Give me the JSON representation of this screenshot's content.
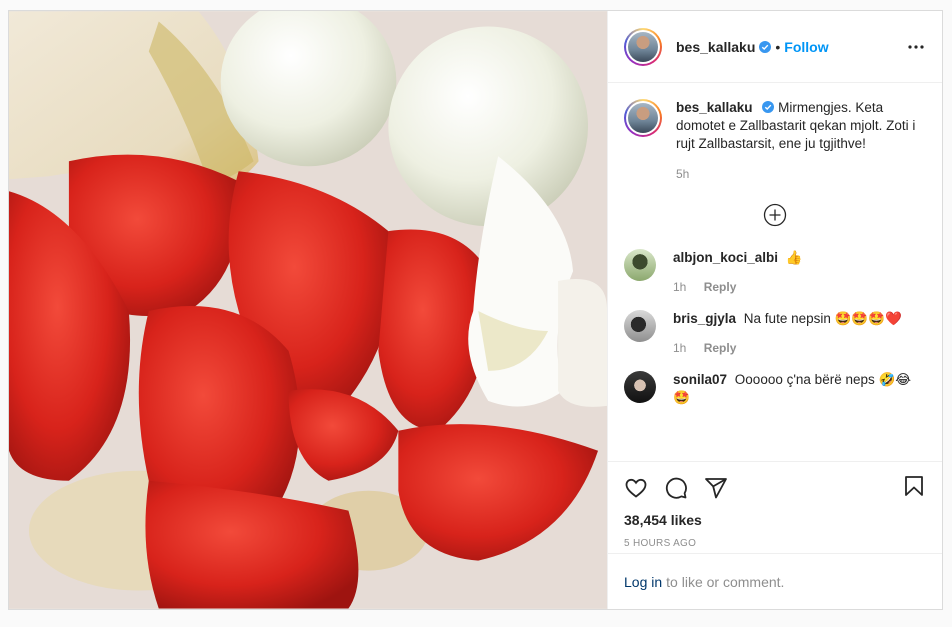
{
  "post": {
    "username": "bes_kallaku",
    "follow_label": "Follow",
    "separator": "•",
    "caption_text": "Mirmengjes. Keta domotet e Zallbastarit qekan mjolt. Zoti i rujt Zallbastarsit, ene ju tgjithve!",
    "caption_time": "5h",
    "likes": "38,454 likes",
    "posted_ago": "5 HOURS AGO",
    "login_link": "Log in",
    "login_rest": "to like or comment."
  },
  "comments": [
    {
      "user": "albjon_koci_albi",
      "text": "👍",
      "time": "1h",
      "reply": "Reply"
    },
    {
      "user": "bris_gjyla",
      "text": "Na fute nepsin 🤩🤩🤩❤️",
      "time": "1h",
      "reply": "Reply"
    },
    {
      "user": "sonila07",
      "text": "Oooooo ç'na bërë neps 🤣😂🤩"
    }
  ],
  "colors": {
    "accent": "#0095f6",
    "link": "#00376b",
    "muted": "#8e8e8e"
  },
  "icons": [
    "verified-icon",
    "more-options-icon",
    "load-more-icon",
    "heart-icon",
    "comment-icon",
    "share-icon",
    "save-icon"
  ]
}
